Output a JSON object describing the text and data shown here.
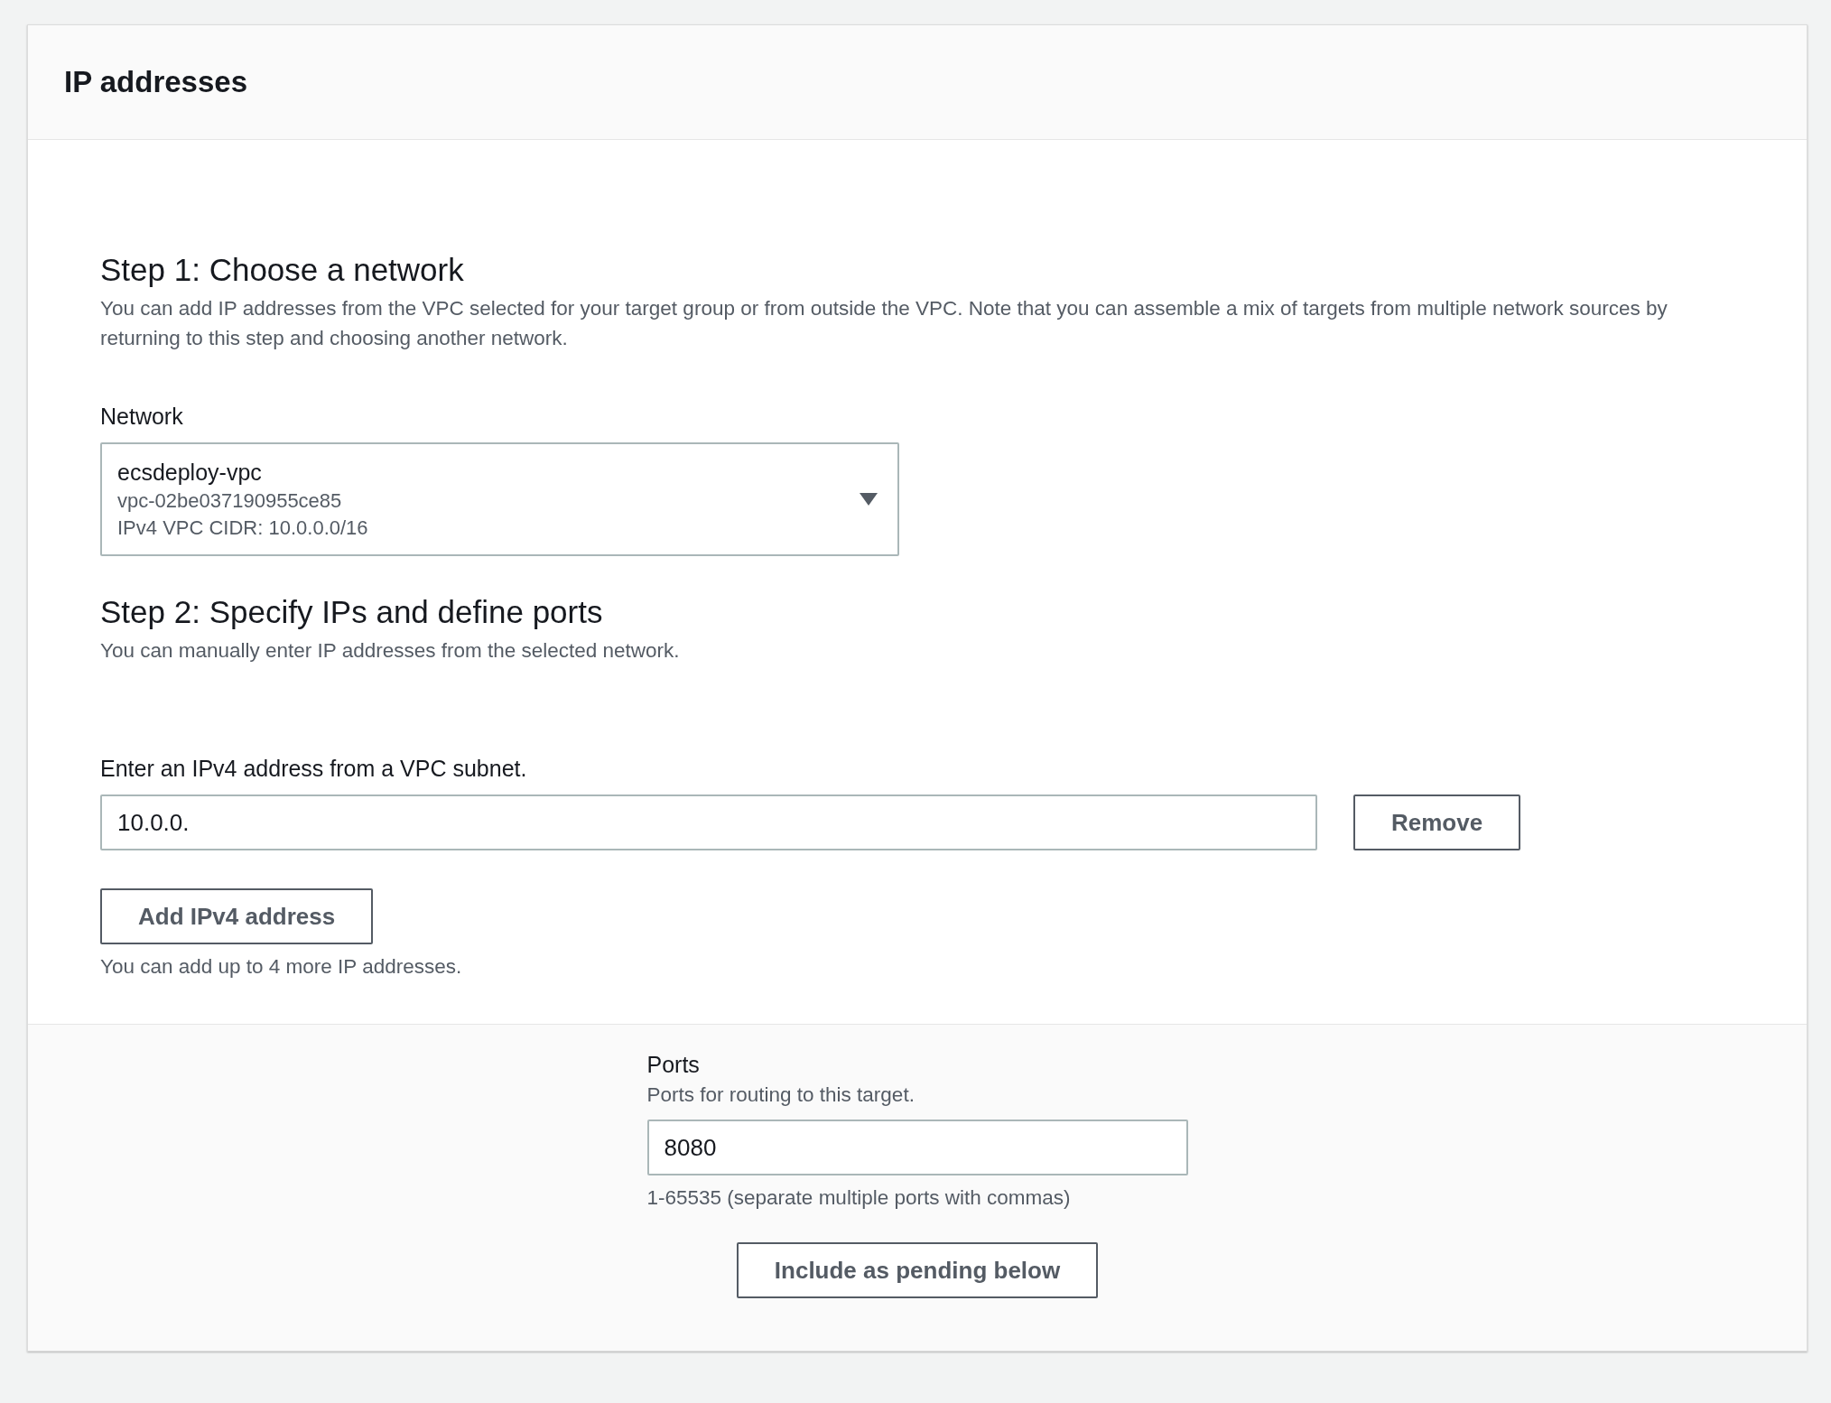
{
  "panel": {
    "title": "IP addresses"
  },
  "step1": {
    "heading": "Step 1: Choose a network",
    "description": "You can add IP addresses from the VPC selected for your target group or from outside the VPC. Note that you can assemble a mix of targets from multiple network sources by returning to this step and choosing another network.",
    "network": {
      "label": "Network",
      "value": "ecsdeploy-vpc",
      "id": "vpc-02be037190955ce85",
      "cidr": "IPv4 VPC CIDR: 10.0.0.0/16"
    }
  },
  "step2": {
    "heading": "Step 2: Specify IPs and define ports",
    "description": "You can manually enter IP addresses from the selected network.",
    "address_label": "Enter an IPv4 address from a VPC subnet.",
    "addresses": [
      {
        "value": "10.0.0.",
        "remove_button": "Remove"
      }
    ],
    "add_button": "Add IPv4 address",
    "add_hint": "You can add up to 4 more IP addresses."
  },
  "ports": {
    "label": "Ports",
    "description": "Ports for routing to this target.",
    "value": "8080",
    "hint": "1-65535 (separate multiple ports with commas)",
    "button": "Include as pending below"
  }
}
